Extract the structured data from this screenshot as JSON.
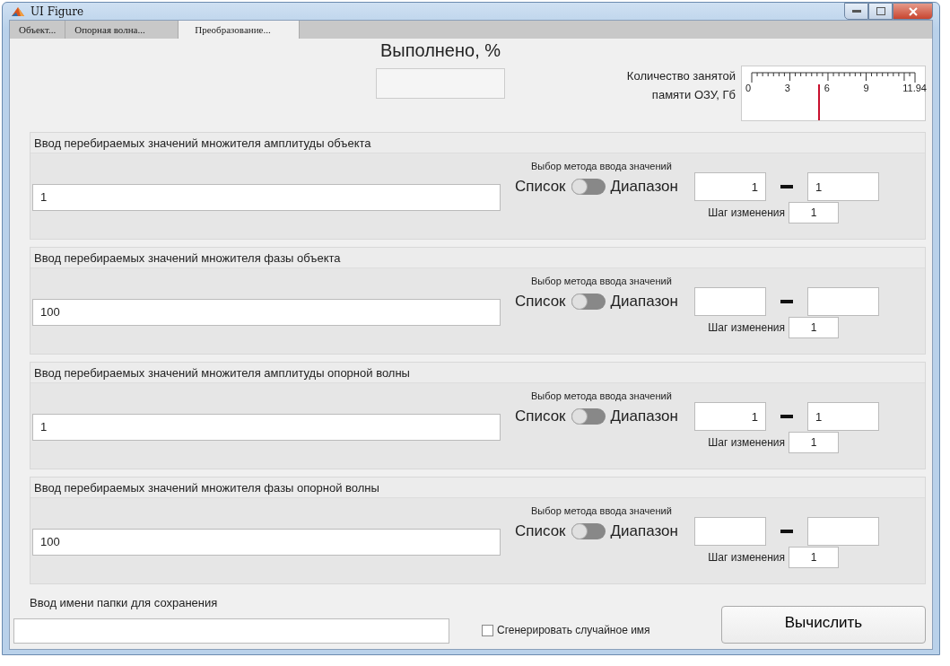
{
  "window": {
    "title": "UI Figure"
  },
  "tabs": [
    {
      "label": "Объект...",
      "selected": false
    },
    {
      "label": "Опорная волна...",
      "selected": false
    },
    {
      "label": "Преобразование...",
      "selected": true
    }
  ],
  "progress": {
    "label": "Выполнено, %"
  },
  "memory": {
    "label_lines": [
      "Количество занятой",
      "памяти ОЗУ, Гб"
    ],
    "ticks": [
      "0",
      "3",
      "6",
      "9",
      "11.94"
    ],
    "level": 0.41
  },
  "panels": [
    {
      "title": "Ввод перебираемых значений множителя амплитуды объекта",
      "method_label": "Выбор метода ввода значений",
      "list_value": "1",
      "toggle_left": "Список",
      "toggle_right": "Диапазон",
      "on": false,
      "range_from": "1",
      "range_to": "1",
      "step_label": "Шаг изменения",
      "step": "1"
    },
    {
      "title": "Ввод перебираемых значений множителя фазы объекта",
      "method_label": "Выбор метода ввода значений",
      "list_value": "100",
      "toggle_left": "Список",
      "toggle_right": "Диапазон",
      "on": false,
      "step_label": "Шаг изменения",
      "step": "1"
    },
    {
      "title": "Ввод перебираемых значений множителя амплитуды опорной волны",
      "method_label": "Выбор метода ввода значений",
      "list_value": "1",
      "toggle_left": "Список",
      "toggle_right": "Диапазон",
      "on": false,
      "range_from": "1",
      "range_to": "1",
      "step_label": "Шаг изменения",
      "step": "1"
    },
    {
      "title": "Ввод перебираемых значений множителя фазы опорной волны",
      "method_label": "Выбор метода ввода значений",
      "list_value": "100",
      "toggle_left": "Список",
      "toggle_right": "Диапазон",
      "on": false,
      "step_label": "Шаг изменения",
      "step": "1"
    }
  ],
  "folder": {
    "label": "Ввод имени папки для сохранения"
  },
  "random_name": {
    "label": "Сгенерировать случайное имя",
    "checked": false
  },
  "compute_button": "Вычислить"
}
